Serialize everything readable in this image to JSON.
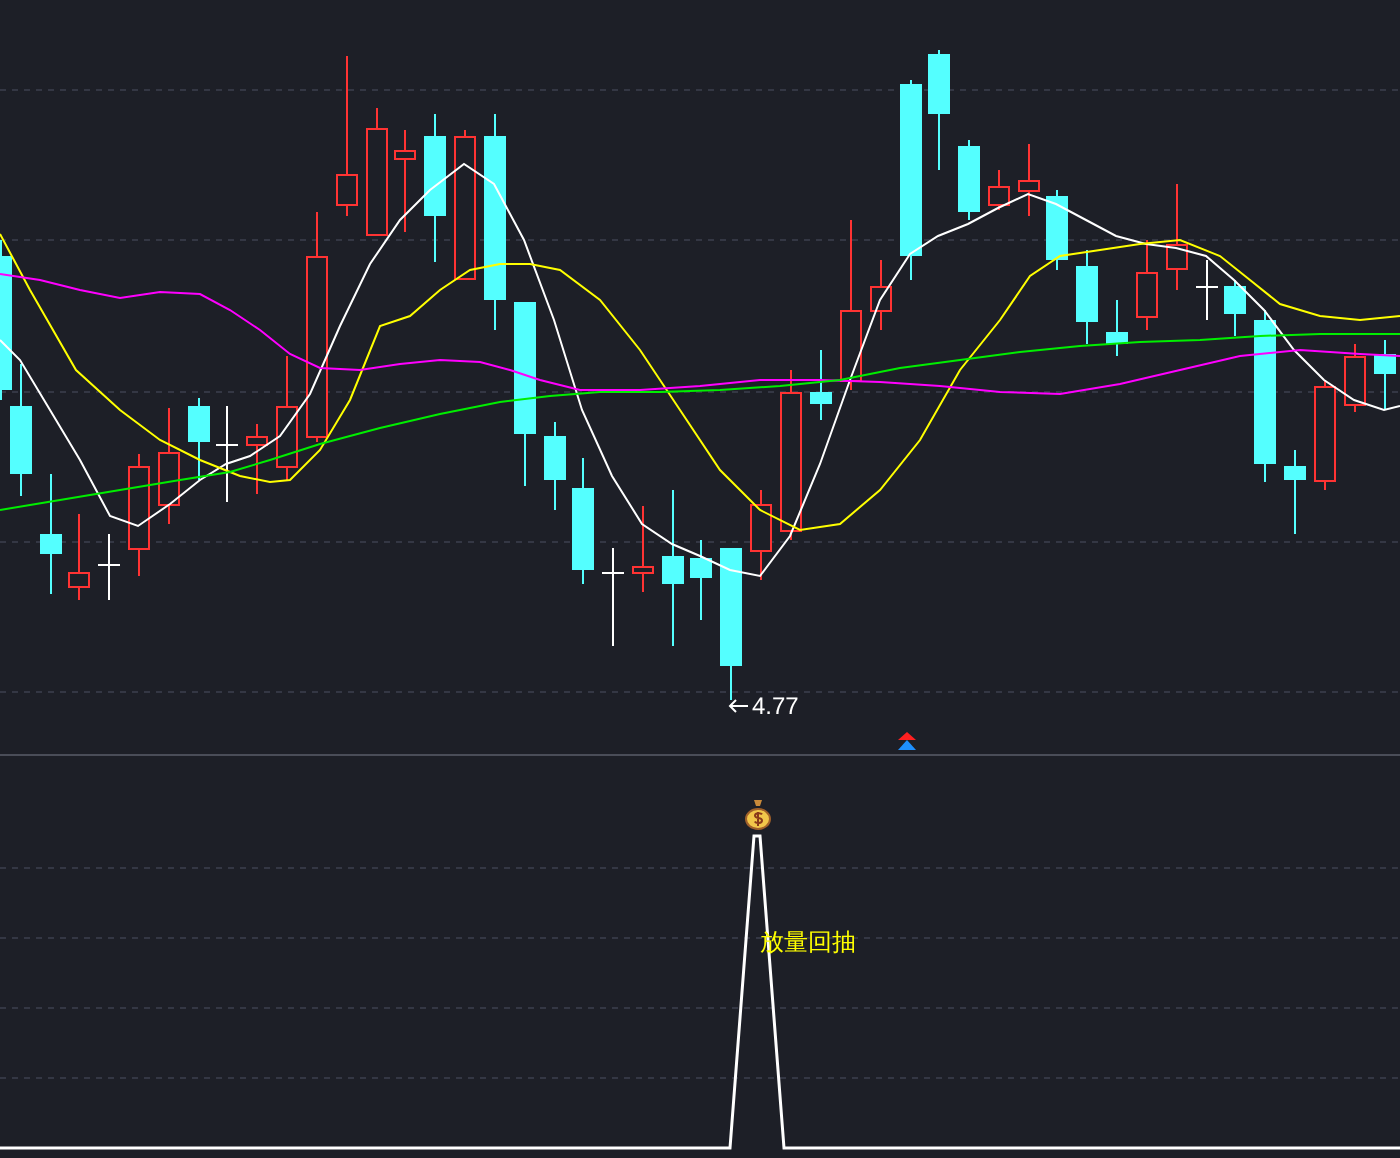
{
  "main_chart": {
    "low_price_label": "4.77"
  },
  "indicator_panel": {
    "signal_label": "放量回抽"
  }
}
